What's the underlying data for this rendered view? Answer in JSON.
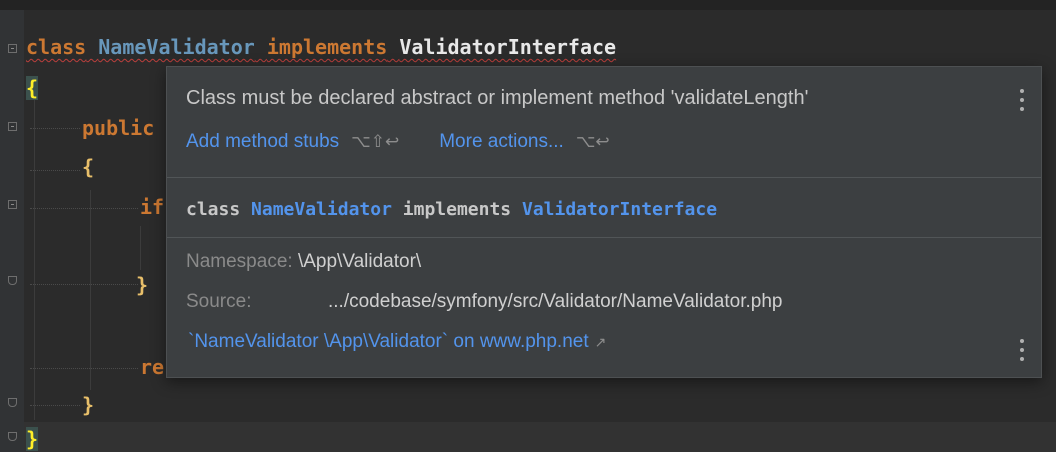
{
  "code": {
    "line1": {
      "kw_class": "class",
      "class_name": "NameValidator",
      "kw_implements": "implements",
      "interface_name": "ValidatorInterface"
    },
    "open_brace": "{",
    "public_fragment": "public",
    "inner_open_brace": "{",
    "if_fragment": "if",
    "inner_if_close": "}",
    "return_fragment": "re",
    "inner_close_brace": "}",
    "close_brace": "}"
  },
  "popup": {
    "error_message": "Class must be declared abstract or implement method 'validateLength'",
    "actions": {
      "add_stubs_label": "Add method stubs",
      "add_stubs_shortcut": "⌥⇧↩",
      "more_actions_label": "More actions...",
      "more_actions_shortcut": "⌥↩"
    },
    "declaration": {
      "kw_class": "class",
      "class_name": "NameValidator",
      "kw_implements": "implements",
      "interface_name": "ValidatorInterface"
    },
    "namespace_label": "Namespace:",
    "namespace_value": "\\App\\Validator\\",
    "source_label": "Source:",
    "source_value": ".../codebase/symfony/src/Validator/NameValidator.php",
    "external_link": "`NameValidator \\App\\Validator` on www.php.net",
    "external_icon": "external-link-arrow",
    "menu_icon": "kebab-menu-icon"
  },
  "colors": {
    "editor_background": "#2b2b2b",
    "keyword": "#cc7832",
    "link": "#5394ec",
    "error_underline": "#bc3f3c",
    "popup_background": "#3c3f41"
  }
}
